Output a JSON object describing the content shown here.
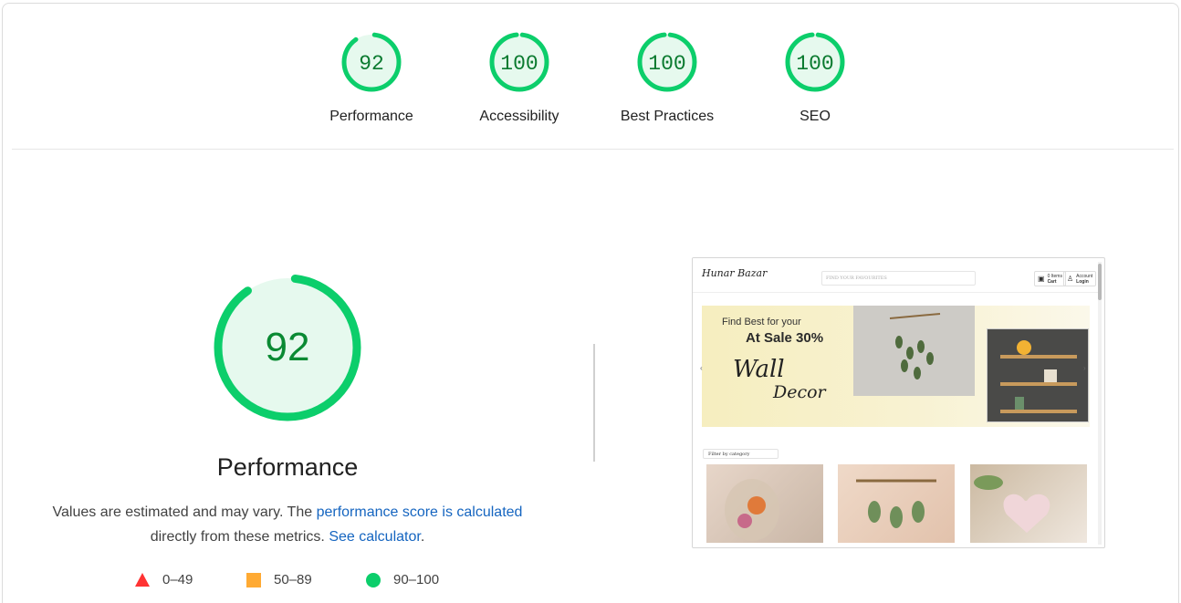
{
  "categories": [
    {
      "label": "Performance",
      "score": "92",
      "value": 92
    },
    {
      "label": "Accessibility",
      "score": "100",
      "value": 100
    },
    {
      "label": "Best Practices",
      "score": "100",
      "value": 100
    },
    {
      "label": "SEO",
      "score": "100",
      "value": 100
    }
  ],
  "main": {
    "score": "92",
    "value": 92,
    "title": "Performance",
    "desc_prefix": "Values are estimated and may vary. The ",
    "desc_link1": "performance score is calculated",
    "desc_middle": "directly from these metrics. ",
    "desc_link2": "See calculator",
    "desc_suffix": "."
  },
  "legend": [
    {
      "range": "0–49",
      "color": "#ff3333"
    },
    {
      "range": "50–89",
      "color": "#ffaa33"
    },
    {
      "range": "90–100",
      "color": "#0cce6b"
    }
  ],
  "colors": {
    "pass": "#0cce6b",
    "pass_bg": "#e6f9ee",
    "score_text": "#0a7a2f"
  },
  "thumbnail": {
    "logo": "Hunar Bazar",
    "search_placeholder": "FIND YOUR FAVOURITES",
    "cart_top": "0 Items",
    "cart_label": "Cart",
    "account_top": "Account",
    "account_label": "Login",
    "banner_line1": "Find Best for your",
    "banner_line2": "At Sale 30%",
    "banner_line3": "Wall",
    "banner_line4": "Decor",
    "filter_label": "Filter by category"
  }
}
